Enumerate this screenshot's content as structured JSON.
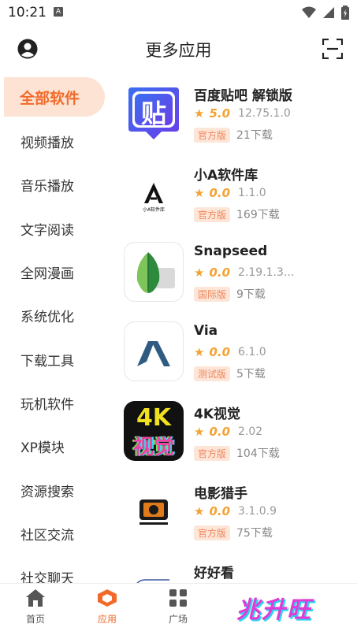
{
  "status": {
    "time": "10:21",
    "notif_letter": "A"
  },
  "header": {
    "title": "更多应用"
  },
  "sidebar": {
    "items": [
      {
        "label": "全部软件"
      },
      {
        "label": "视频播放"
      },
      {
        "label": "音乐播放"
      },
      {
        "label": "文字阅读"
      },
      {
        "label": "全网漫画"
      },
      {
        "label": "系统优化"
      },
      {
        "label": "下载工具"
      },
      {
        "label": "玩机软件"
      },
      {
        "label": "XP模块"
      },
      {
        "label": "资源搜索"
      },
      {
        "label": "社区交流"
      },
      {
        "label": "社交聊天"
      }
    ]
  },
  "apps": [
    {
      "name": "百度贴吧 解锁版",
      "rating": "5.0",
      "version": "12.75.1.0",
      "badge": "官方版",
      "downloads": "21下载"
    },
    {
      "name": "小A软件库",
      "rating": "0.0",
      "version": "1.1.0",
      "badge": "官方版",
      "downloads": "169下载"
    },
    {
      "name": "Snapseed",
      "rating": "0.0",
      "version": "2.19.1.3...",
      "badge": "国际版",
      "downloads": "9下载"
    },
    {
      "name": "Via",
      "rating": "0.0",
      "version": "6.1.0",
      "badge": "测试版",
      "downloads": "5下载"
    },
    {
      "name": "4K视觉",
      "rating": "0.0",
      "version": "2.02",
      "badge": "官方版",
      "downloads": "104下载"
    },
    {
      "name": "电影猎手",
      "rating": "0.0",
      "version": "3.1.0.9",
      "badge": "官方版",
      "downloads": "75下载"
    },
    {
      "name": "好好看",
      "rating": "",
      "version": "",
      "badge": "",
      "downloads": ""
    }
  ],
  "icons": {
    "app1_glyph": "贴",
    "app2_letter": "A",
    "app2_caption": "小A软件库",
    "app5_top": "4K",
    "app5_bottom": "视觉"
  },
  "nav": {
    "home": "首页",
    "apps": "应用",
    "plaza": "广场",
    "logo": "兆升旺"
  },
  "colors": {
    "accent": "#f26a2a",
    "active_bg": "#fde3d3",
    "star": "#f4a233"
  }
}
